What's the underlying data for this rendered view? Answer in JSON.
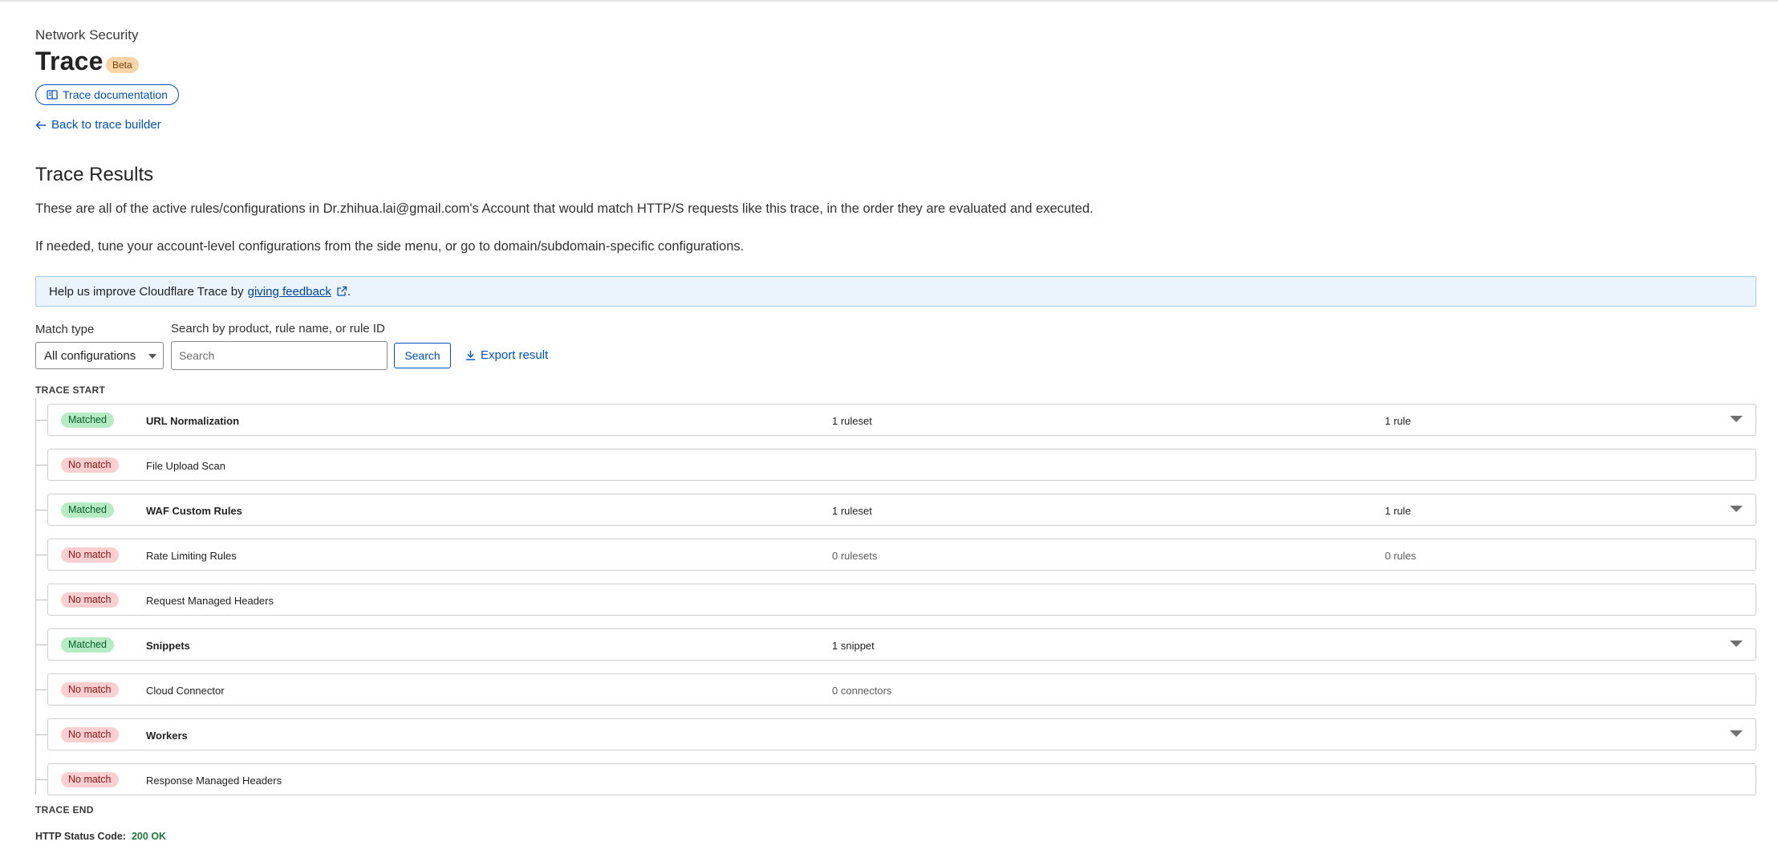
{
  "header": {
    "section": "Network Security",
    "title": "Trace",
    "badge": "Beta",
    "doc_button": "Trace documentation",
    "back_link": "Back to trace builder"
  },
  "results": {
    "title": "Trace Results",
    "description_1": "These are all of the active rules/configurations in Dr.zhihua.lai@gmail.com's Account that would match HTTP/S requests like this trace, in the order they are evaluated and executed.",
    "description_2": "If needed, tune your account-level configurations from the side menu, or go to domain/subdomain-specific configurations."
  },
  "banner": {
    "text": "Help us improve Cloudflare Trace by",
    "link": "giving feedback",
    "suffix": "."
  },
  "filters": {
    "match_type_label": "Match type",
    "match_type_value": "All configurations",
    "search_label": "Search by product, rule name, or rule ID",
    "search_placeholder": "Search",
    "search_button": "Search",
    "export_link": "Export result"
  },
  "trace": {
    "start_label": "TRACE START",
    "end_label": "TRACE END",
    "rows": [
      {
        "status": "Matched",
        "name": "URL Normalization",
        "col_a": "1 ruleset",
        "col_b": "1 rule",
        "expandable": true
      },
      {
        "status": "No match",
        "name": "File Upload Scan",
        "col_a": "",
        "col_b": "",
        "expandable": false
      },
      {
        "status": "Matched",
        "name": "WAF Custom Rules",
        "col_a": "1 ruleset",
        "col_b": "1 rule",
        "expandable": true
      },
      {
        "status": "No match",
        "name": "Rate Limiting Rules",
        "col_a": "0 rulesets",
        "col_b": "0 rules",
        "expandable": false
      },
      {
        "status": "No match",
        "name": "Request Managed Headers",
        "col_a": "",
        "col_b": "",
        "expandable": false
      },
      {
        "status": "Matched",
        "name": "Snippets",
        "col_a": "1 snippet",
        "col_b": "",
        "expandable": true
      },
      {
        "status": "No match",
        "name": "Cloud Connector",
        "col_a": "0 connectors",
        "col_b": "",
        "expandable": false
      },
      {
        "status": "No match",
        "name": "Workers",
        "col_a": "",
        "col_b": "",
        "expandable": true
      },
      {
        "status": "No match",
        "name": "Response Managed Headers",
        "col_a": "",
        "col_b": "",
        "expandable": false
      }
    ]
  },
  "status": {
    "label": "HTTP Status Code:",
    "value": "200 OK"
  },
  "colors": {
    "link": "#0051c3",
    "matched_bg": "#b5ecc4",
    "nomatch_bg": "#fbcfcf",
    "ok": "#1e7a39"
  }
}
